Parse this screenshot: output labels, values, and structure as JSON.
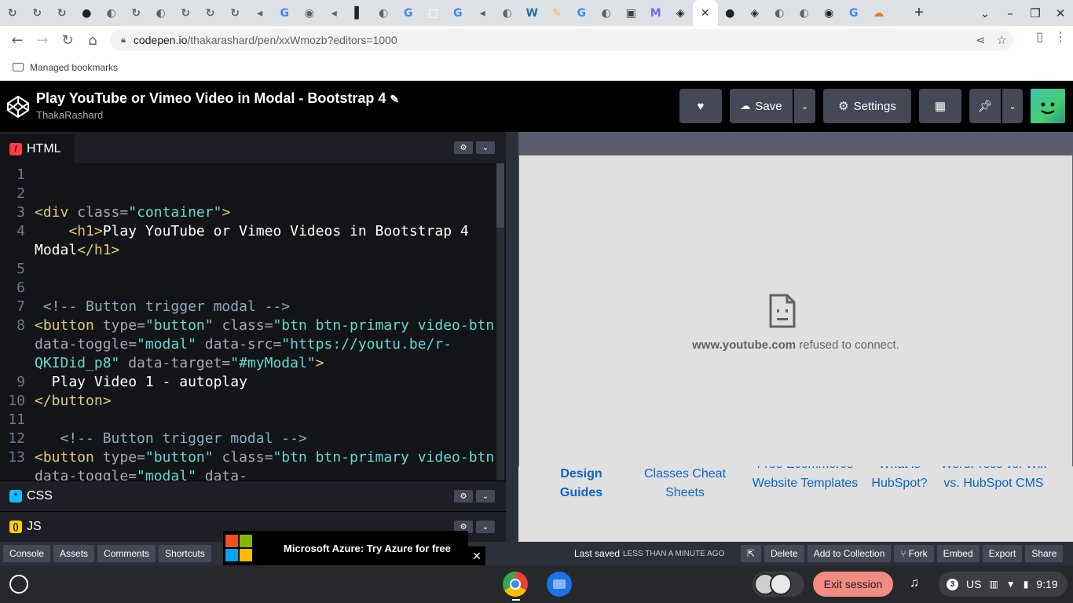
{
  "browser": {
    "tabs": [
      {
        "icon": "codepen-refresh-icon",
        "color": "#5f6368",
        "glyph": "↻"
      },
      {
        "icon": "codepen-refresh-icon",
        "color": "#5f6368",
        "glyph": "↻"
      },
      {
        "icon": "codepen-refresh-icon",
        "color": "#5f6368",
        "glyph": "↻"
      },
      {
        "icon": "github-icon",
        "color": "#202124",
        "glyph": "●"
      },
      {
        "icon": "globe-icon",
        "color": "#5f6368",
        "glyph": "◐"
      },
      {
        "icon": "codepen-refresh-icon",
        "color": "#5f6368",
        "glyph": "↻"
      },
      {
        "icon": "globe-icon",
        "color": "#5f6368",
        "glyph": "◐"
      },
      {
        "icon": "codepen-refresh-icon",
        "color": "#5f6368",
        "glyph": "↻"
      },
      {
        "icon": "codepen-refresh-icon",
        "color": "#5f6368",
        "glyph": "↻"
      },
      {
        "icon": "codepen-refresh-icon",
        "color": "#5f6368",
        "glyph": "↻"
      },
      {
        "icon": "audio-icon",
        "color": "#5f6368",
        "glyph": "◂"
      },
      {
        "icon": "google-icon",
        "color": "#4285f4",
        "glyph": "G"
      },
      {
        "icon": "app-icon",
        "color": "#5f6368",
        "glyph": "◉"
      },
      {
        "icon": "audio-icon",
        "color": "#5f6368",
        "glyph": "◂"
      },
      {
        "icon": "page-icon",
        "color": "#202124",
        "glyph": "▌"
      },
      {
        "icon": "globe-icon",
        "color": "#5f6368",
        "glyph": "◐"
      },
      {
        "icon": "google-icon",
        "color": "#4285f4",
        "glyph": "G"
      },
      {
        "icon": "blank-icon",
        "color": "#ffffff",
        "glyph": "□"
      },
      {
        "icon": "google-icon",
        "color": "#4285f4",
        "glyph": "G"
      },
      {
        "icon": "audio-icon",
        "color": "#5f6368",
        "glyph": "◂"
      },
      {
        "icon": "globe-icon",
        "color": "#5f6368",
        "glyph": "◐"
      },
      {
        "icon": "wordpress-icon",
        "color": "#21759b",
        "glyph": "W"
      },
      {
        "icon": "pen-icon",
        "color": "#f4c430",
        "glyph": "✎"
      },
      {
        "icon": "google-icon",
        "color": "#4285f4",
        "glyph": "G"
      },
      {
        "icon": "globe-icon",
        "color": "#5f6368",
        "glyph": "◐"
      },
      {
        "icon": "terminal-icon",
        "color": "#2d4a3e",
        "glyph": "▣"
      },
      {
        "icon": "mail-icon",
        "color": "#7b68ee",
        "glyph": "M"
      },
      {
        "icon": "codepen-icon",
        "color": "#202124",
        "glyph": "◈"
      },
      {
        "icon": "codepen-icon",
        "color": "#202124",
        "glyph": "◈",
        "active": true
      },
      {
        "icon": "github-icon",
        "color": "#202124",
        "glyph": "●"
      },
      {
        "icon": "codepen-icon",
        "color": "#202124",
        "glyph": "◈"
      },
      {
        "icon": "globe-icon",
        "color": "#5f6368",
        "glyph": "◐"
      },
      {
        "icon": "globe-icon",
        "color": "#5f6368",
        "glyph": "◐"
      },
      {
        "icon": "eye-icon",
        "color": "#202124",
        "glyph": "◉"
      },
      {
        "icon": "google-icon",
        "color": "#4285f4",
        "glyph": "G"
      },
      {
        "icon": "soundcloud-icon",
        "color": "#f26f23",
        "glyph": "☁"
      }
    ],
    "new_tab": "+",
    "url_domain": "codepen.io",
    "url_path": "/thakarashard/pen/xxWmozb?editors=1000",
    "bookmarks_label": "Managed bookmarks"
  },
  "codepen": {
    "title": "Play YouTube or Vimeo Video in Modal - Bootstrap 4",
    "author": "ThakaRashard",
    "save_label": "Save",
    "settings_label": "Settings"
  },
  "editor": {
    "html_tab": "HTML",
    "css_tab": "CSS",
    "js_tab": "JS",
    "line_numbers": [
      "1",
      "2",
      "3",
      "4",
      "",
      "5",
      "6",
      "7",
      "8",
      "",
      "",
      "9",
      "10",
      "11",
      "12",
      "13",
      ""
    ],
    "fold_marks": [
      "",
      "",
      "▾",
      "▾",
      "",
      "",
      "",
      "▾",
      "▾",
      "",
      "",
      "",
      "",
      "",
      "▾",
      "▾",
      ""
    ]
  },
  "preview": {
    "refused_domain": "www.youtube.com",
    "refused_text": " refused to connect.",
    "links": [
      "Design\nGuides",
      "Classes Cheat\nSheets",
      "Free Ecommerce\nWebsite Templates",
      "What is\nHubSpot?",
      "WordPress vs. Wix\nvs. HubSpot CMS"
    ]
  },
  "footer": {
    "console": "Console",
    "assets": "Assets",
    "comments": "Comments",
    "shortcuts": "Shortcuts",
    "ad_text": "Microsoft Azure: Try Azure for free",
    "last_saved": "Last saved",
    "saved_time": "LESS THAN A MINUTE AGO",
    "delete": "Delete",
    "add_to_collection": "Add to Collection",
    "fork": "Fork",
    "embed": "Embed",
    "export": "Export",
    "share": "Share"
  },
  "shelf": {
    "exit_session": "Exit session",
    "notification_count": "3",
    "keyboard": "US",
    "clock": "9:19"
  }
}
